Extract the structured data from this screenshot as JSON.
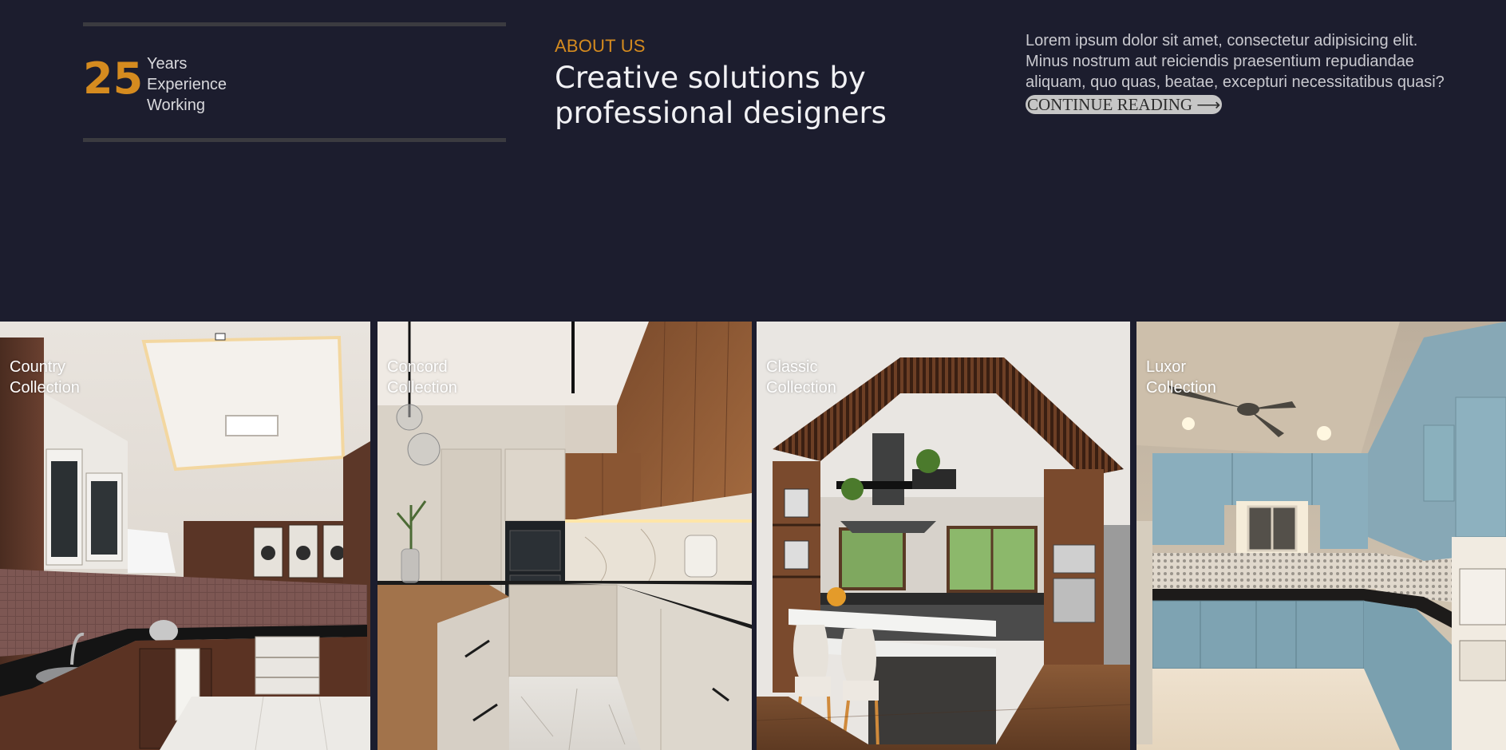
{
  "about": {
    "years_number": "25",
    "years_label_lines": [
      "Years",
      "Experience",
      "Working"
    ],
    "eyebrow": "ABOUT US",
    "heading_lines": [
      "Creative solutions by",
      "professional designers"
    ],
    "paragraph": "Lorem ipsum dolor sit amet, consectetur adipisicing elit. Minus nostrum aut reiciendis praesentium repudiandae aliquam, quo quas, beatae, excepturi necessitatibus quasi?",
    "cta_label": "CONTINUE READING ⟶"
  },
  "collections": [
    {
      "line1": "Country",
      "line2": "Collection",
      "image": "kitchen-photo-wood-white"
    },
    {
      "line1": "Concord",
      "line2": "Collection",
      "image": "kitchen-photo-beige-wood"
    },
    {
      "line1": "Classic",
      "line2": "Collection",
      "image": "kitchen-photo-island-slats"
    },
    {
      "line1": "Luxor",
      "line2": "Collection",
      "image": "kitchen-photo-blue-cabinets"
    }
  ],
  "colors": {
    "background": "#1c1d2e",
    "accent": "#d58b1f",
    "divider": "#3b3b40",
    "button_bg": "#c6c6c6"
  }
}
